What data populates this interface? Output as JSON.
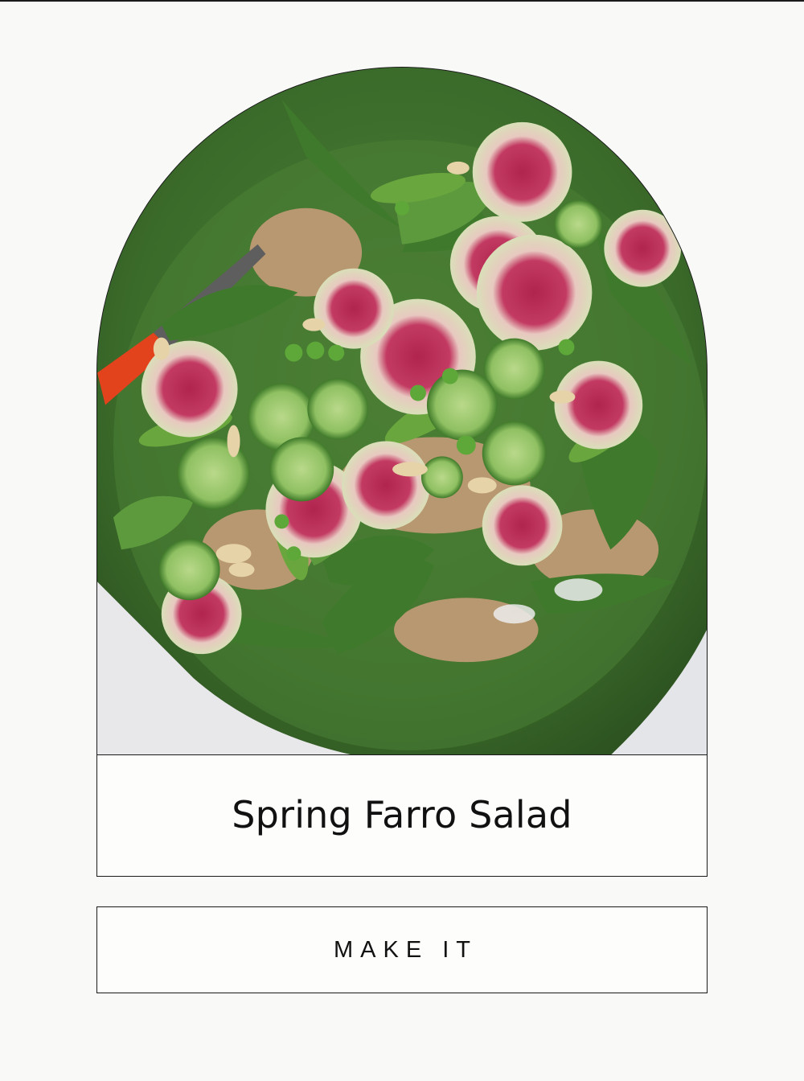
{
  "recipe": {
    "title": "Spring Farro Salad",
    "image_icon": "salad-photo",
    "cta_label": "MAKE IT"
  },
  "colors": {
    "background": "#f9f9f8",
    "border": "#1a1a1a",
    "text": "#111111"
  }
}
